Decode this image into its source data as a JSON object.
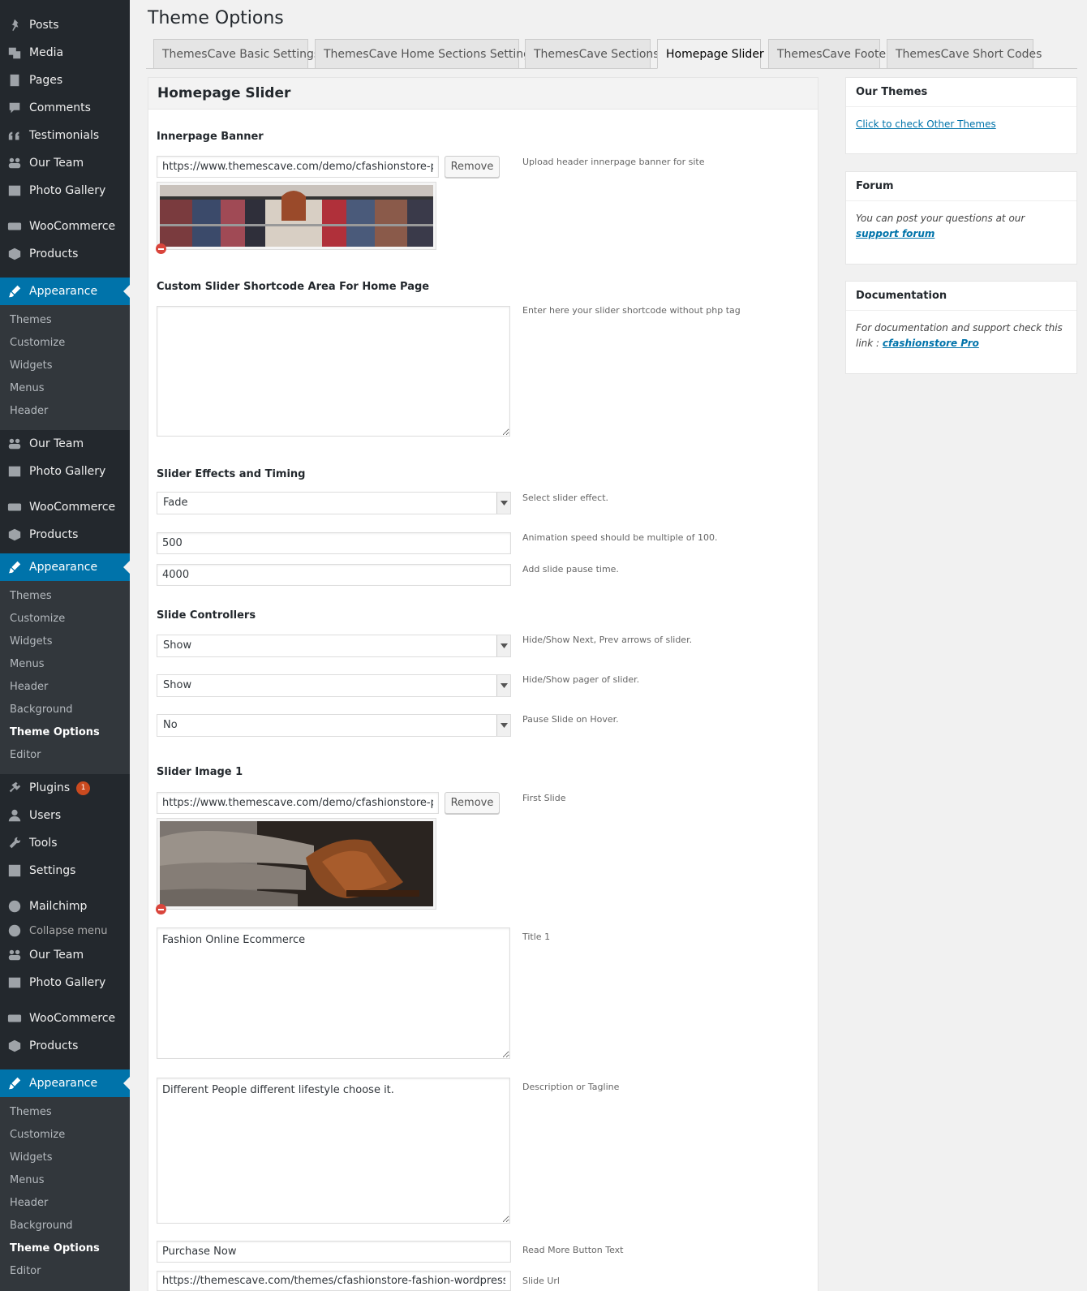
{
  "sidebar": {
    "top_items": [
      {
        "label": "Posts",
        "icon": "pin-icon"
      },
      {
        "label": "Media",
        "icon": "media-icon"
      },
      {
        "label": "Pages",
        "icon": "pages-icon"
      },
      {
        "label": "Comments",
        "icon": "comments-icon"
      },
      {
        "label": "Testimonials",
        "icon": "quote-icon"
      },
      {
        "label": "Our Team",
        "icon": "team-icon"
      },
      {
        "label": "Photo Gallery",
        "icon": "gallery-icon"
      },
      {
        "label": "WooCommerce",
        "icon": "woo-icon"
      },
      {
        "label": "Products",
        "icon": "products-icon"
      }
    ],
    "appearance_label": "Appearance",
    "submenu_a": [
      "Themes",
      "Customize",
      "Widgets",
      "Menus",
      "Header"
    ],
    "submenu_b": [
      "Themes",
      "Customize",
      "Widgets",
      "Menus",
      "Header",
      "Background",
      "Theme Options",
      "Editor"
    ],
    "group_items": [
      {
        "label": "Our Team"
      },
      {
        "label": "Photo Gallery"
      },
      {
        "label": "WooCommerce"
      },
      {
        "label": "Products"
      }
    ],
    "plugins_label": "Plugins",
    "plugins_badge": "1",
    "users_label": "Users",
    "tools_label": "Tools",
    "settings_label": "Settings",
    "mailchimp_label": "Mailchimp",
    "collapse_label": "Collapse menu",
    "active_color": "#0073aa"
  },
  "page_title": "Theme Options",
  "tabs": [
    {
      "label": "ThemesCave Basic Settings"
    },
    {
      "label": "ThemesCave Home Sections Settings"
    },
    {
      "label": "ThemesCave Sections"
    },
    {
      "label": "Homepage Slider"
    },
    {
      "label": "ThemesCave Footer"
    },
    {
      "label": "ThemesCave Short Codes"
    }
  ],
  "panel": {
    "header": "Homepage Slider",
    "innerpage_banner": {
      "title": "Innerpage Banner",
      "url": "https://www.themescave.com/demo/cfashionstore-pro/",
      "remove_label": "Remove",
      "desc": "Upload header innerpage banner for site"
    },
    "custom_shortcode": {
      "title": "Custom Slider Shortcode Area For Home Page",
      "value": "",
      "desc": "Enter here your slider shortcode without php tag"
    },
    "effects": {
      "title": "Slider Effects and Timing",
      "effect_value": "Fade",
      "effect_desc": "Select slider effect.",
      "speed_value": "500",
      "speed_desc": "Animation speed should be multiple of 100.",
      "pause_value": "4000",
      "pause_desc": "Add slide pause time."
    },
    "controllers": {
      "title": "Slide Controllers",
      "arrows_value": "Show",
      "arrows_desc": "Hide/Show Next, Prev arrows of slider.",
      "pager_value": "Show",
      "pager_desc": "Hide/Show pager of slider.",
      "hover_value": "No",
      "hover_desc": "Pause Slide on Hover."
    },
    "slide1": {
      "title": "Slider Image 1",
      "url": "https://www.themescave.com/demo/cfashionstore-pro/",
      "remove_label": "Remove",
      "desc": "First Slide",
      "title_value": "Fashion Online Ecommerce",
      "title_desc": "Title 1",
      "tagline_value": "Different People different lifestyle choose it.",
      "tagline_desc": "Description or Tagline",
      "button_value": "Purchase Now",
      "button_desc": "Read More Button Text",
      "slide_url_value": "https://themescave.com/themes/cfashionstore-fashion-wordpress-theme/",
      "slide_url_desc": "Slide Url"
    }
  },
  "boxes": {
    "themes": {
      "title": "Our Themes",
      "link": "Click to check Other Themes"
    },
    "forum": {
      "title": "Forum",
      "text": "You can post your questions at our",
      "link": "support forum"
    },
    "docs": {
      "title": "Documentation",
      "text": "For documentation and support check this link :",
      "link": "cfashionstore Pro"
    }
  }
}
